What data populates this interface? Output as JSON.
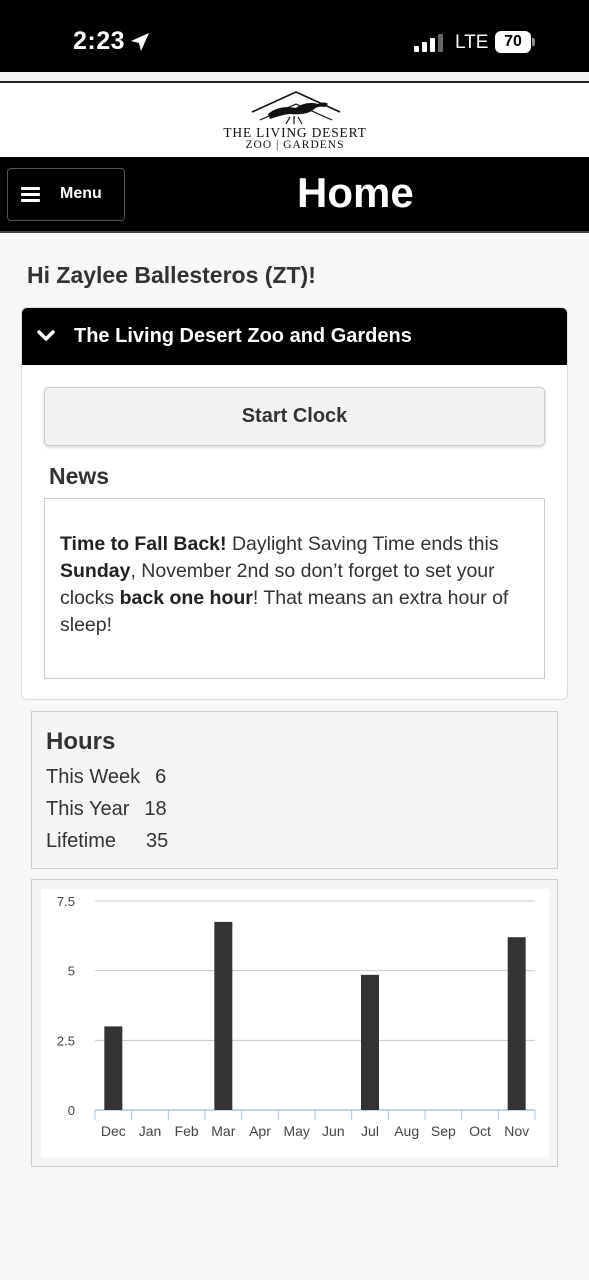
{
  "status_bar": {
    "time": "2:23",
    "network": "LTE",
    "battery": "70"
  },
  "logo": {
    "line1": "THE LIVING DESERT",
    "line2": "ZOO | GARDENS"
  },
  "nav": {
    "menu_label": "Menu",
    "title": "Home"
  },
  "greeting": "Hi Zaylee Ballesteros (ZT)!",
  "org": {
    "title": "The Living Desert Zoo and Gardens",
    "clock_button": "Start Clock",
    "news_heading": "News",
    "news": {
      "p1_bold": "Time to Fall Back!",
      "p2": " Daylight Saving Time ends this ",
      "p3_bold": "Sunday",
      "p4": ", November 2nd so don’t forget to set your clocks ",
      "p5_bold": "back one hour",
      "p6": "! That means an extra hour of sleep!"
    }
  },
  "hours": {
    "title": "Hours",
    "rows": [
      {
        "label": "This Week",
        "value": "6"
      },
      {
        "label": "This Year",
        "value": "18"
      },
      {
        "label": "Lifetime",
        "value": "35"
      }
    ]
  },
  "chart_data": {
    "type": "bar",
    "categories": [
      "Dec",
      "Jan",
      "Feb",
      "Mar",
      "Apr",
      "May",
      "Jun",
      "Jul",
      "Aug",
      "Sep",
      "Oct",
      "Nov"
    ],
    "values": [
      3,
      0,
      0,
      6.75,
      0,
      0,
      0,
      4.85,
      0,
      0,
      0,
      6.2
    ],
    "y_ticks": [
      "0",
      "2.5",
      "5",
      "7.5"
    ],
    "ylim": [
      0,
      7.5
    ],
    "bar_color": "#333333",
    "grid": true
  }
}
